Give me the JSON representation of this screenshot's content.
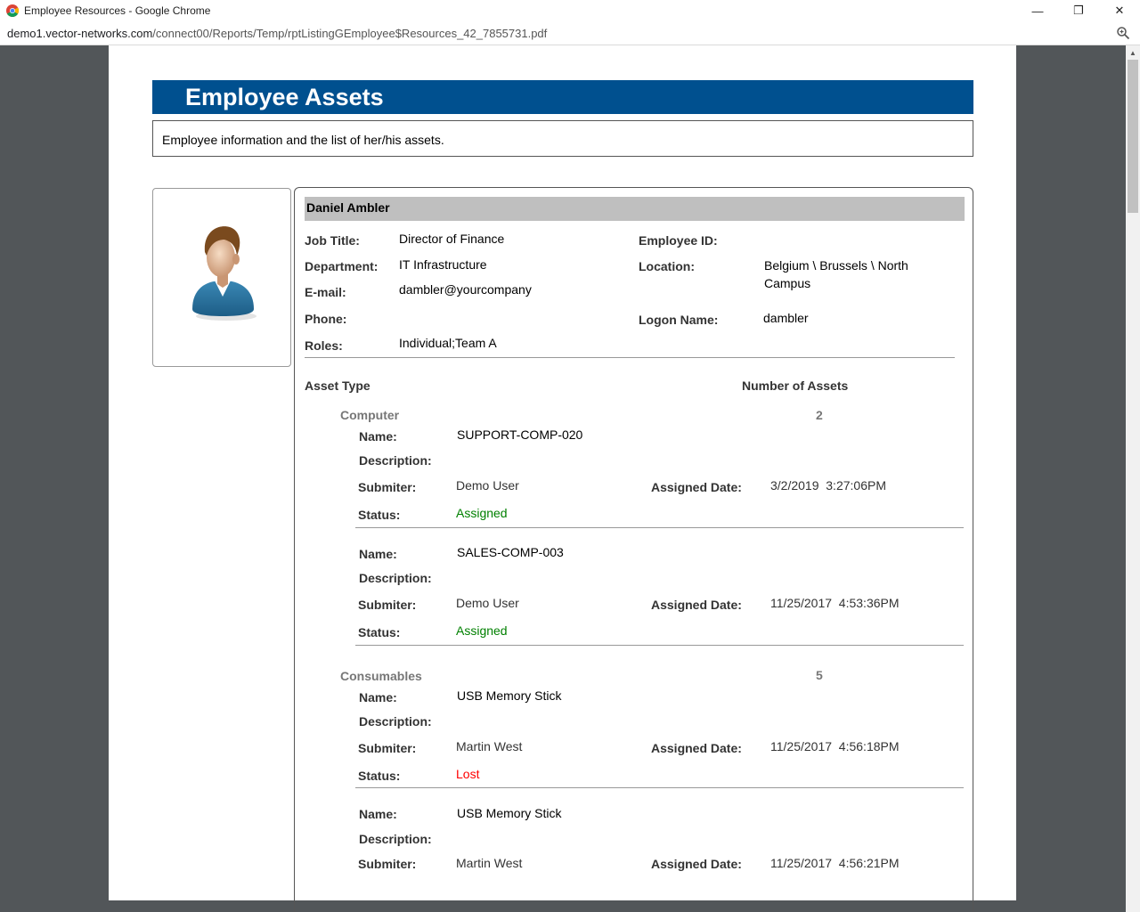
{
  "window": {
    "title": "Employee Resources - Google Chrome",
    "url_host": "demo1.vector-networks.com",
    "url_path": "/connect00/Reports/Temp/rptListingGEmployee$Resources_42_7855731.pdf",
    "minimize_glyph": "—",
    "maximize_glyph": "❐",
    "close_glyph": "✕"
  },
  "report": {
    "title": "Employee Assets",
    "description": "Employee information and the list of her/his assets."
  },
  "employee": {
    "name": "Daniel Ambler",
    "job_title_label": "Job Title:",
    "job_title": "Director of Finance",
    "department_label": "Department:",
    "department": "IT Infrastructure",
    "email_label": "E-mail:",
    "email": "dambler@yourcompany",
    "phone_label": "Phone:",
    "roles_label": "Roles:",
    "roles": "Individual;Team A",
    "employee_id_label": "Employee ID:",
    "location_label": "Location:",
    "location_line1": "Belgium \\ Brussels \\ North",
    "location_line2": "Campus",
    "logon_label": "Logon Name:",
    "logon": "dambler"
  },
  "assets": {
    "type_header": "Asset Type",
    "count_header": "Number of Assets",
    "labels": {
      "name": "Name:",
      "description": "Description:",
      "submitter": "Submiter:",
      "assigned_date": "Assigned Date:",
      "status": "Status:"
    },
    "groups": [
      {
        "type": "Computer",
        "count": "2",
        "items": [
          {
            "name": "SUPPORT-COMP-020",
            "submitter": "Demo User",
            "assigned_date": "3/2/2019  3:27:06PM",
            "status": "Assigned"
          },
          {
            "name": "SALES-COMP-003",
            "submitter": "Demo User",
            "assigned_date": "11/25/2017  4:53:36PM",
            "status": "Assigned"
          }
        ]
      },
      {
        "type": "Consumables",
        "count": "5",
        "items": [
          {
            "name": "USB Memory Stick",
            "submitter": "Martin West",
            "assigned_date": "11/25/2017  4:56:18PM",
            "status": "Lost"
          },
          {
            "name": "USB Memory Stick",
            "submitter": "Martin West",
            "assigned_date": "11/25/2017  4:56:21PM",
            "status": ""
          }
        ]
      }
    ]
  },
  "colors": {
    "header_blue": "#00508f",
    "status_assigned": "#008000",
    "status_lost": "#ff0000"
  },
  "icons": [
    "chrome-logo-icon",
    "zoom-icon",
    "avatar-icon"
  ]
}
